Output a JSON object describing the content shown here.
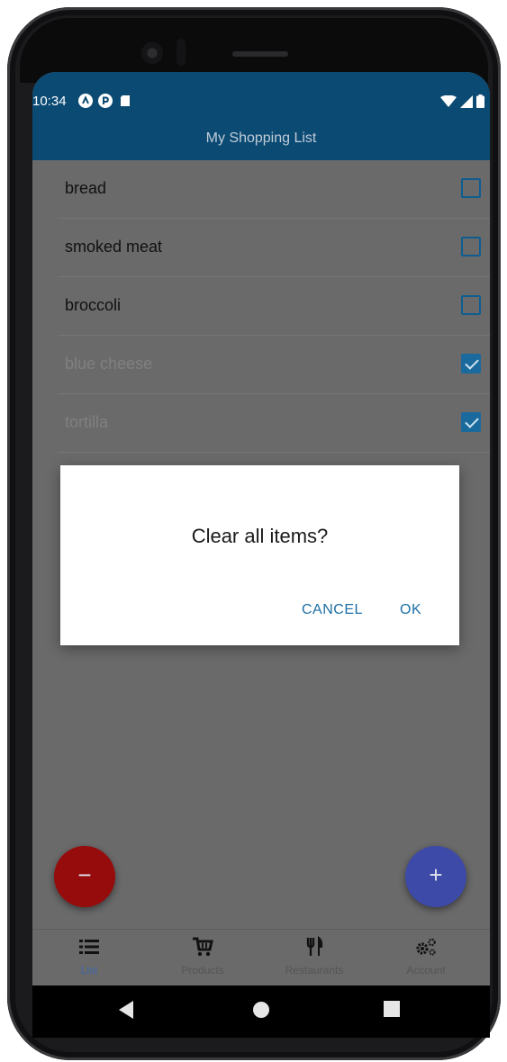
{
  "status_bar": {
    "time": "10:34",
    "left_icons": [
      "a-circle-icon",
      "p-circle-icon",
      "sd-card-icon"
    ],
    "right_icons": [
      "wifi-icon",
      "signal-icon",
      "battery-icon"
    ]
  },
  "app": {
    "title": "My Shopping List",
    "accent_color": "#0b4a73"
  },
  "list": {
    "items": [
      {
        "label": "bread",
        "checked": false
      },
      {
        "label": "smoked meat",
        "checked": false
      },
      {
        "label": "broccoli",
        "checked": false
      },
      {
        "label": "blue cheese",
        "checked": true
      },
      {
        "label": "tortilla",
        "checked": true
      }
    ]
  },
  "dialog": {
    "title": "Clear all items?",
    "cancel_label": "CANCEL",
    "ok_label": "OK"
  },
  "fabs": {
    "remove_label": "−",
    "add_label": "+"
  },
  "bottom_nav": {
    "items": [
      {
        "label": "List",
        "icon": "list-icon",
        "active": true
      },
      {
        "label": "Products",
        "icon": "cart-icon",
        "active": false
      },
      {
        "label": "Restaurants",
        "icon": "fork-knife-icon",
        "active": false
      },
      {
        "label": "Account",
        "icon": "gears-icon",
        "active": false
      }
    ]
  },
  "system_nav": [
    "back-icon",
    "home-icon",
    "recents-icon"
  ]
}
